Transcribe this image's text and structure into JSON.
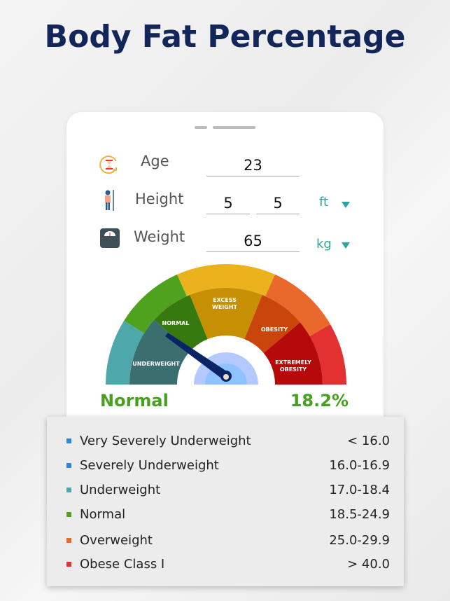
{
  "title": "Body Fat Percentage",
  "form": {
    "age": {
      "label": "Age",
      "value": "23",
      "icon": "hourglass-icon"
    },
    "height": {
      "label": "Height",
      "value_ft": "5",
      "value_in": "5",
      "unit": "ft",
      "icon": "person-height-icon"
    },
    "weight": {
      "label": "Weight",
      "value": "65",
      "unit": "kg",
      "icon": "scale-icon"
    }
  },
  "gauge": {
    "segments": [
      {
        "label": "UNDERWEIGHT",
        "outer": "#4ea8a9",
        "inner": "#3b6e6f"
      },
      {
        "label": "NORMAL",
        "outer": "#4ea21d",
        "inner": "#367a0f"
      },
      {
        "label": "EXCESS WEIGHT",
        "outer": "#eab21c",
        "inner": "#c78f03"
      },
      {
        "label": "OBESITY",
        "outer": "#e9692c",
        "inner": "#c9450c"
      },
      {
        "label": "EXTREMELY OBESITY",
        "outer": "#e33131",
        "inner": "#b40a0a"
      }
    ],
    "labels": {
      "underweight": "UNDERWEIGHT",
      "normal": "NORMAL",
      "excess1": "EXCESS",
      "excess2": "WEIGHT",
      "obesity": "OBESITY",
      "extreme1": "EXTREMELY",
      "extreme2": "OBESITY"
    },
    "result_category": "Normal",
    "result_value": "18.2%",
    "result_color": "#47a01f"
  },
  "categories": [
    {
      "name": "Very Severely Underweight",
      "range": "< 16.0",
      "color": "#2f86d6"
    },
    {
      "name": "Severely Underweight",
      "range": "16.0-16.9",
      "color": "#2f86d6"
    },
    {
      "name": "Underweight",
      "range": "17.0-18.4",
      "color": "#4ea8a9"
    },
    {
      "name": "Normal",
      "range": "18.5-24.9",
      "color": "#4ea21d"
    },
    {
      "name": "Overweight",
      "range": "25.0-29.9",
      "color": "#e9692c"
    },
    {
      "name": "Obese Class I",
      "range": "> 40.0",
      "color": "#e33131"
    }
  ]
}
